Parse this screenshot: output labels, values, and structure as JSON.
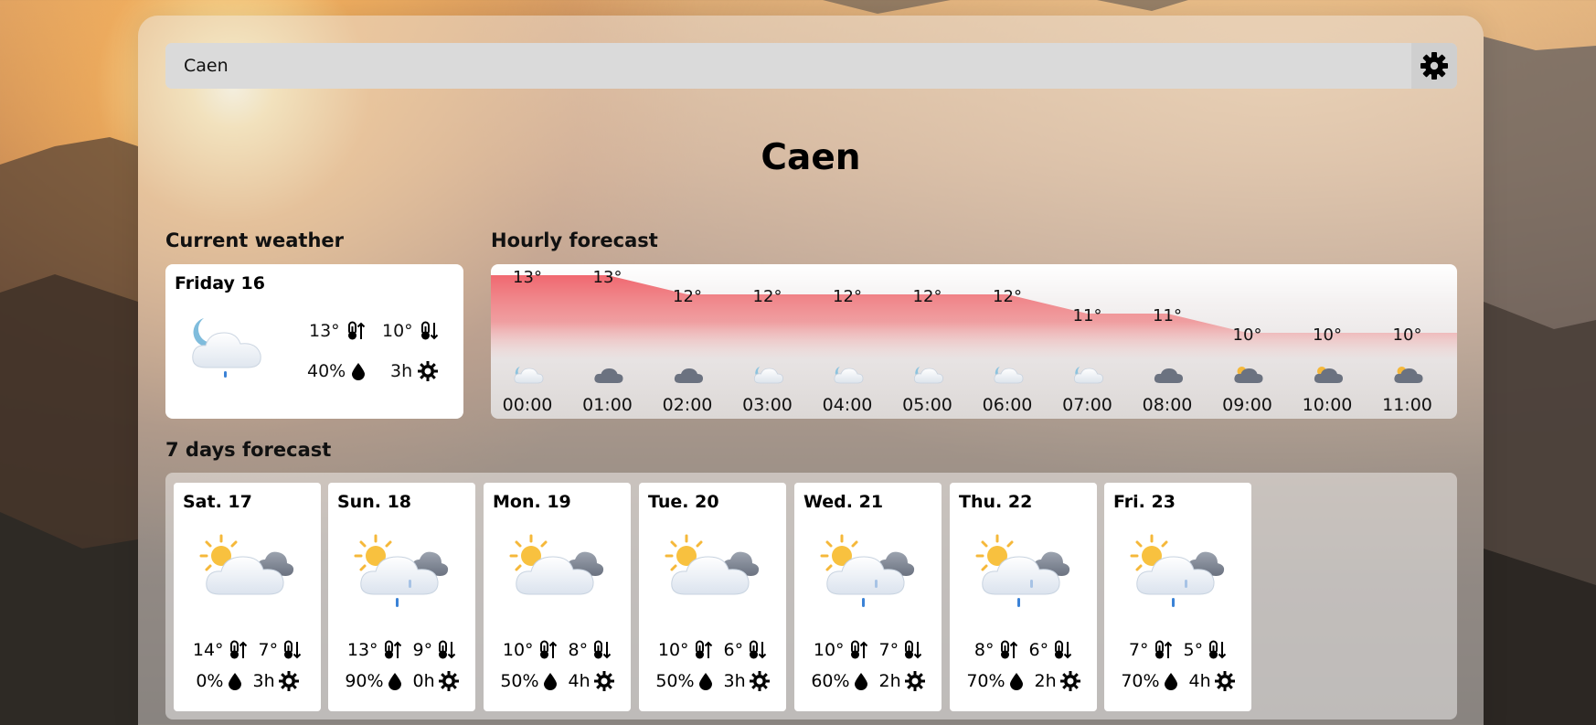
{
  "search": {
    "value": "Caen"
  },
  "city": "Caen",
  "current": {
    "title": "Current weather",
    "day": "Friday 16",
    "icon": "partly-cloudy-night-drizzle-icon",
    "max": "13°",
    "min": "10°",
    "precip": "40%",
    "sun": "3h"
  },
  "hourly": {
    "title": "Hourly forecast",
    "items": [
      {
        "time": "00:00",
        "temp": 13,
        "label": "13°",
        "icon": "partly-cloudy-night-icon"
      },
      {
        "time": "01:00",
        "temp": 13,
        "label": "13°",
        "icon": "overcast-night-icon"
      },
      {
        "time": "02:00",
        "temp": 12,
        "label": "12°",
        "icon": "overcast-icon"
      },
      {
        "time": "03:00",
        "temp": 12,
        "label": "12°",
        "icon": "partly-cloudy-night-icon"
      },
      {
        "time": "04:00",
        "temp": 12,
        "label": "12°",
        "icon": "partly-cloudy-night-icon"
      },
      {
        "time": "05:00",
        "temp": 12,
        "label": "12°",
        "icon": "partly-cloudy-night-icon"
      },
      {
        "time": "06:00",
        "temp": 12,
        "label": "12°",
        "icon": "partly-cloudy-night-icon"
      },
      {
        "time": "07:00",
        "temp": 11,
        "label": "11°",
        "icon": "partly-cloudy-night-icon"
      },
      {
        "time": "08:00",
        "temp": 11,
        "label": "11°",
        "icon": "overcast-icon"
      },
      {
        "time": "09:00",
        "temp": 10,
        "label": "10°",
        "icon": "overcast-day-icon"
      },
      {
        "time": "10:00",
        "temp": 10,
        "label": "10°",
        "icon": "overcast-day-icon"
      },
      {
        "time": "11:00",
        "temp": 10,
        "label": "10°",
        "icon": "overcast-day-icon"
      }
    ],
    "fill_color": "#ef6f74"
  },
  "week": {
    "title": "7 days forecast",
    "days": [
      {
        "name": "Sat. 17",
        "max": "14°",
        "min": "7°",
        "precip": "0%",
        "sun": "3h",
        "icon": "partly-cloudy-day-icon"
      },
      {
        "name": "Sun. 18",
        "max": "13°",
        "min": "9°",
        "precip": "90%",
        "sun": "0h",
        "icon": "partly-cloudy-day-drizzle-icon"
      },
      {
        "name": "Mon. 19",
        "max": "10°",
        "min": "8°",
        "precip": "50%",
        "sun": "4h",
        "icon": "partly-cloudy-day-icon"
      },
      {
        "name": "Tue. 20",
        "max": "10°",
        "min": "6°",
        "precip": "50%",
        "sun": "3h",
        "icon": "partly-cloudy-day-icon"
      },
      {
        "name": "Wed. 21",
        "max": "10°",
        "min": "7°",
        "precip": "60%",
        "sun": "2h",
        "icon": "partly-cloudy-day-drizzle-icon"
      },
      {
        "name": "Thu. 22",
        "max": "8°",
        "min": "6°",
        "precip": "70%",
        "sun": "2h",
        "icon": "partly-cloudy-day-drizzle-icon"
      },
      {
        "name": "Fri. 23",
        "max": "7°",
        "min": "5°",
        "precip": "70%",
        "sun": "4h",
        "icon": "partly-cloudy-day-drizzle-icon"
      }
    ]
  }
}
